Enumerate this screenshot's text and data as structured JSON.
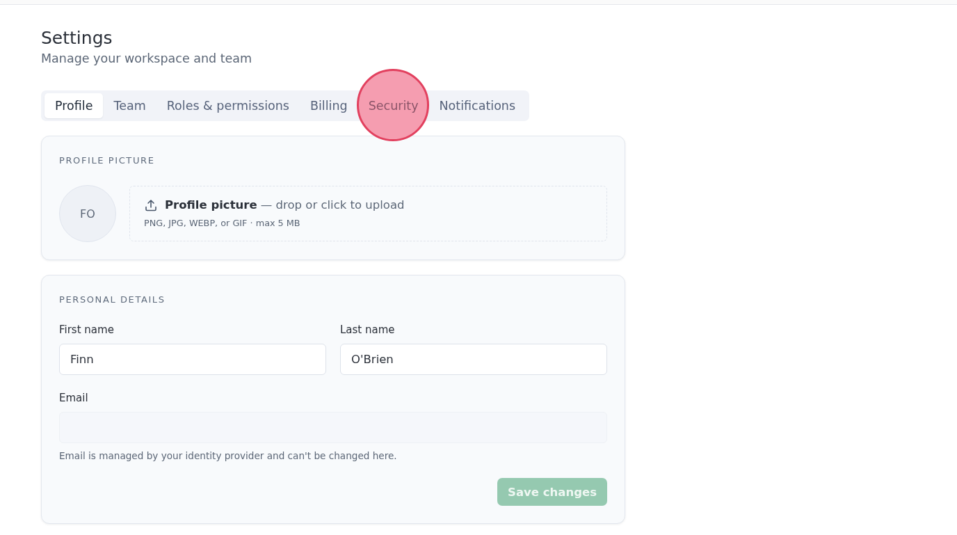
{
  "page": {
    "title": "Settings",
    "subtitle": "Manage your workspace and team"
  },
  "tabs": [
    {
      "label": "Profile",
      "selected": true,
      "clicked": false
    },
    {
      "label": "Team",
      "selected": false,
      "clicked": false
    },
    {
      "label": "Roles & permissions",
      "selected": false,
      "clicked": false
    },
    {
      "label": "Billing",
      "selected": false,
      "clicked": false
    },
    {
      "label": "Security",
      "selected": false,
      "clicked": true
    },
    {
      "label": "Notifications",
      "selected": false,
      "clicked": false
    }
  ],
  "profile_picture": {
    "heading": "PROFILE PICTURE",
    "avatar_initials": "FO",
    "upload": {
      "text": "**Profile picture** — drop or click to upload",
      "formats": "PNG, JPG, WEBP, or GIF · max 5 MB"
    }
  },
  "personal_details": {
    "heading": "PERSONAL DETAILS",
    "name_fields": [
      {
        "label": "First name",
        "value": "Finn",
        "disabled": false
      },
      {
        "label": "Last name",
        "value": "O'Brien",
        "disabled": false
      }
    ],
    "email": {
      "label": "Email",
      "disabled": true,
      "help": "Email is managed by your identity provider and can't be changed here."
    },
    "save_button": {
      "label": "Save changes",
      "disabled": true
    }
  }
}
